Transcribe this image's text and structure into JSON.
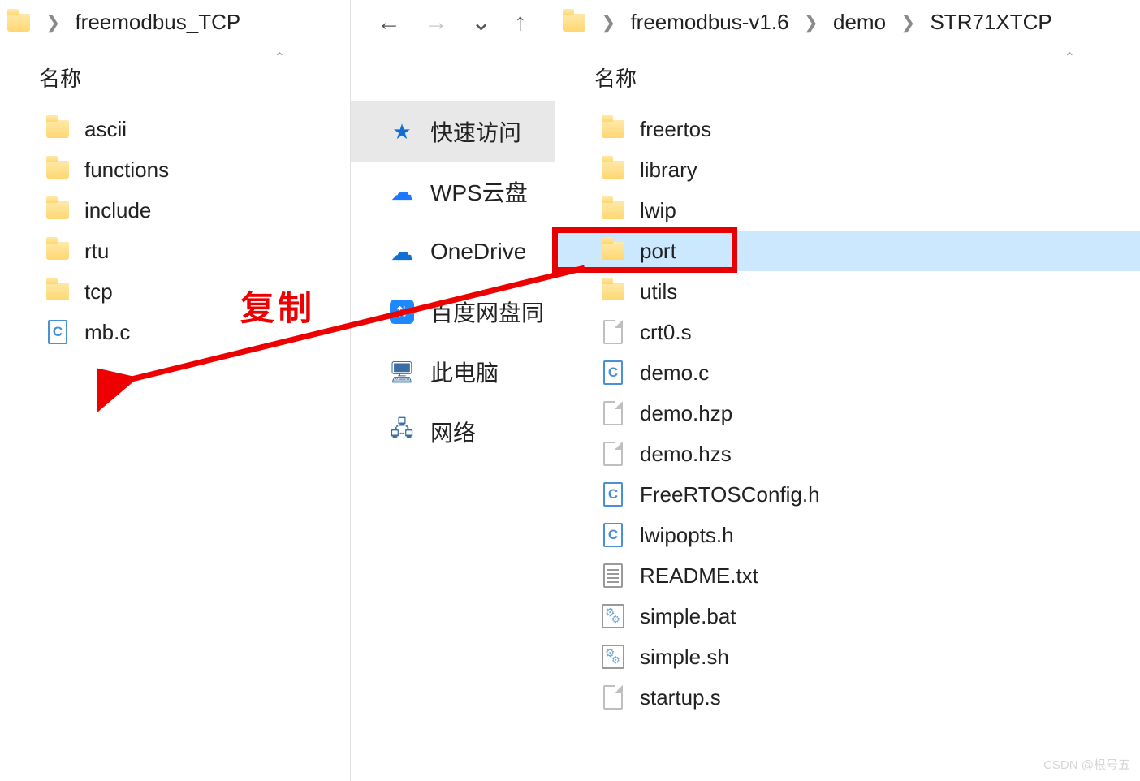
{
  "leftPane": {
    "breadcrumb": [
      "freemodbus_TCP"
    ],
    "columnHeader": "名称",
    "items": [
      {
        "name": "ascii",
        "icon": "folder"
      },
      {
        "name": "functions",
        "icon": "folder"
      },
      {
        "name": "include",
        "icon": "folder"
      },
      {
        "name": "rtu",
        "icon": "folder"
      },
      {
        "name": "tcp",
        "icon": "folder"
      },
      {
        "name": "mb.c",
        "icon": "c"
      }
    ]
  },
  "midPane": {
    "nav": {
      "back": "←",
      "forward": "→",
      "recent": "⌄",
      "up": "↑"
    },
    "items": [
      {
        "name": "快速访问",
        "icon": "star",
        "selected": true
      },
      {
        "name": "WPS云盘",
        "icon": "cloudblue"
      },
      {
        "name": "OneDrive",
        "icon": "onedrive"
      },
      {
        "name": "百度网盘同",
        "icon": "baidu"
      },
      {
        "name": "此电脑",
        "icon": "pc"
      },
      {
        "name": "网络",
        "icon": "net"
      }
    ]
  },
  "rightPane": {
    "breadcrumb": [
      "freemodbus-v1.6",
      "demo",
      "STR71XTCP"
    ],
    "columnHeader": "名称",
    "items": [
      {
        "name": "freertos",
        "icon": "folder"
      },
      {
        "name": "library",
        "icon": "folder"
      },
      {
        "name": "lwip",
        "icon": "folder"
      },
      {
        "name": "port",
        "icon": "folder",
        "selected": true,
        "highlighted": true
      },
      {
        "name": "utils",
        "icon": "folder"
      },
      {
        "name": "crt0.s",
        "icon": "blank"
      },
      {
        "name": "demo.c",
        "icon": "c"
      },
      {
        "name": "demo.hzp",
        "icon": "blank"
      },
      {
        "name": "demo.hzs",
        "icon": "blank"
      },
      {
        "name": "FreeRTOSConfig.h",
        "icon": "c"
      },
      {
        "name": "lwipopts.h",
        "icon": "c"
      },
      {
        "name": "README.txt",
        "icon": "txt"
      },
      {
        "name": "simple.bat",
        "icon": "bat"
      },
      {
        "name": "simple.sh",
        "icon": "bat"
      },
      {
        "name": "startup.s",
        "icon": "blank"
      }
    ]
  },
  "annotation": "复制",
  "watermark": "CSDN @根号五"
}
